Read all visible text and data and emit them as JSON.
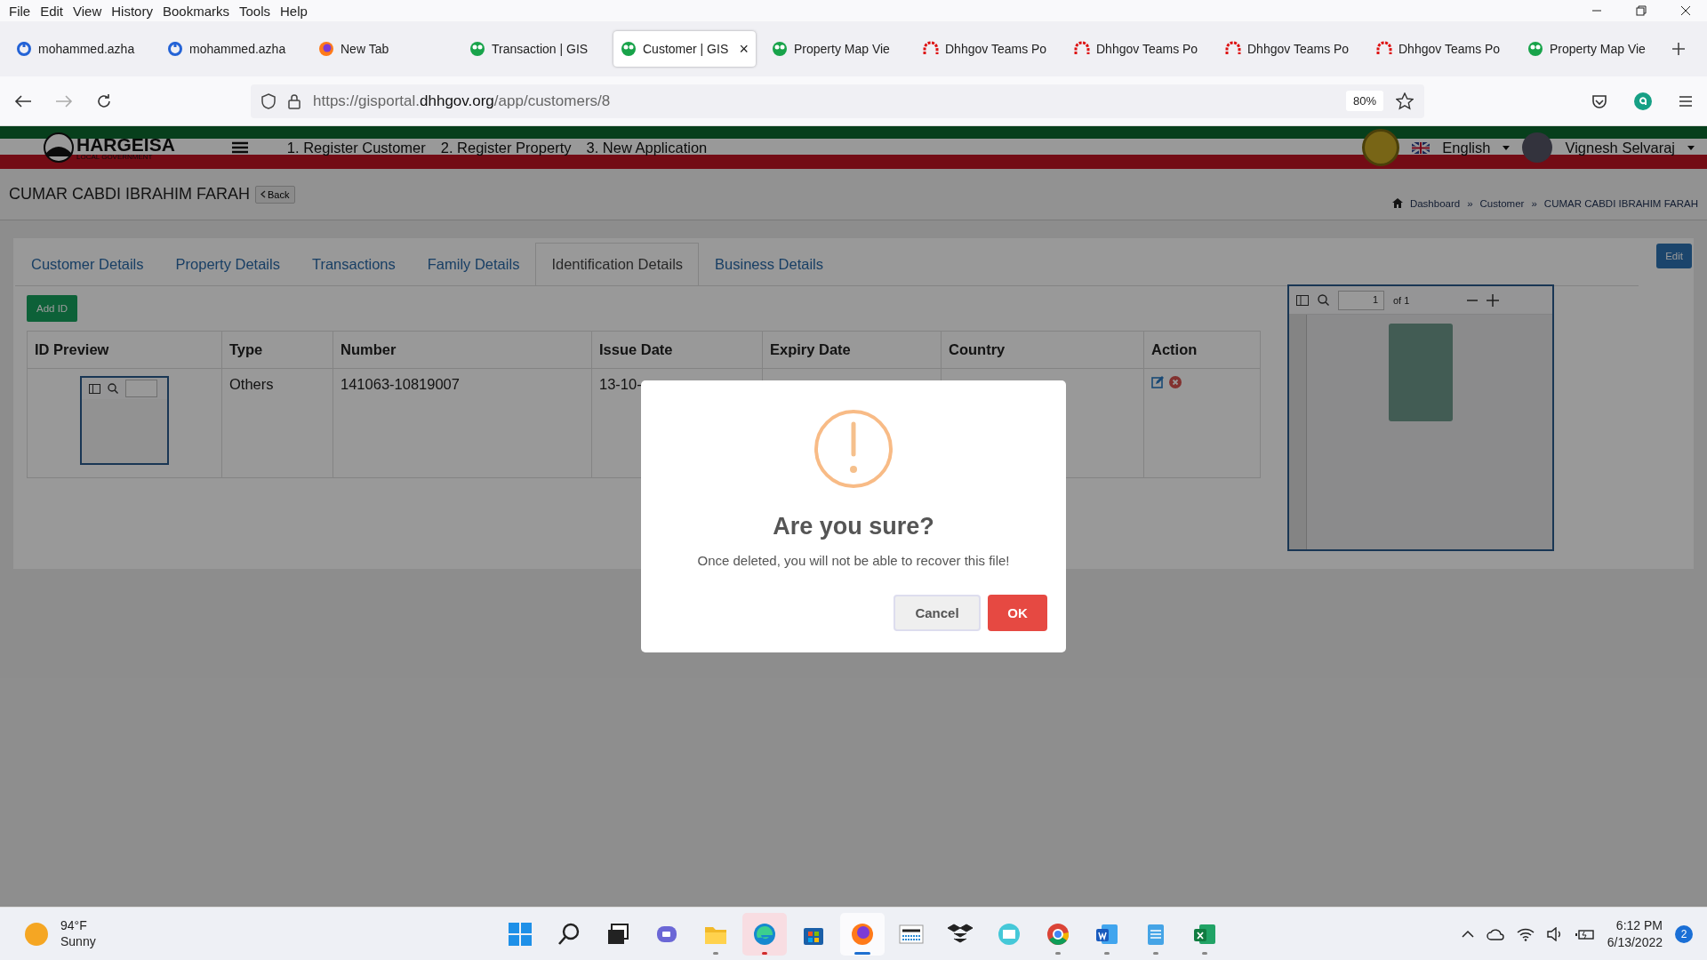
{
  "menu_bar": [
    "File",
    "Edit",
    "View",
    "History",
    "Bookmarks",
    "Tools",
    "Help"
  ],
  "browser_tabs": [
    {
      "title": "mohammed.azha",
      "kind": "ring",
      "selected": false
    },
    {
      "title": "mohammed.azha",
      "kind": "ring",
      "selected": false
    },
    {
      "title": "New Tab",
      "kind": "fox",
      "selected": false
    },
    {
      "title": "Transaction | GIS",
      "kind": "globe",
      "selected": false
    },
    {
      "title": "Customer | GIS",
      "kind": "globe",
      "selected": true,
      "close": "×"
    },
    {
      "title": "Property Map Vie",
      "kind": "globe",
      "selected": false
    },
    {
      "title": "Dhhgov Teams Po",
      "kind": "arch",
      "selected": false
    },
    {
      "title": "Dhhgov Teams Po",
      "kind": "arch",
      "selected": false
    },
    {
      "title": "Dhhgov Teams Po",
      "kind": "arch",
      "selected": false
    },
    {
      "title": "Dhhgov Teams Po",
      "kind": "arch",
      "selected": false
    },
    {
      "title": "Property Map Vie",
      "kind": "globe",
      "selected": false
    }
  ],
  "address_bar": {
    "url_start": "https://gisportal.",
    "url_domain": "dhhgov.org",
    "url_path": "/app/customers/8",
    "zoom": "80%"
  },
  "app_header": {
    "logo_title": "HARGEISA",
    "logo_subtitle": "LOCAL GOVERNMENT",
    "nav_links": [
      "1. Register Customer",
      "2. Register Property",
      "3. New Application"
    ],
    "language": "English",
    "user": "Vignesh Selvaraj"
  },
  "page_title": {
    "name": "CUMAR CABDI IBRAHIM FARAH",
    "back": "Back"
  },
  "breadcrumbs": {
    "separator": "»",
    "items": [
      "Dashboard",
      "Customer",
      "CUMAR CABDI IBRAHIM FARAH"
    ]
  },
  "tabs": [
    {
      "label": "Customer Details",
      "selected": false
    },
    {
      "label": "Property Details",
      "selected": false
    },
    {
      "label": "Transactions",
      "selected": false
    },
    {
      "label": "Family Details",
      "selected": false
    },
    {
      "label": "Identification Details",
      "selected": true
    },
    {
      "label": "Business Details",
      "selected": false
    }
  ],
  "edit_button": "Edit",
  "add_id_button": "Add ID",
  "table": {
    "columns": [
      "ID Preview",
      "Type",
      "Number",
      "Issue Date",
      "Expiry Date",
      "Country",
      "Action"
    ],
    "rows": [
      {
        "type": "Others",
        "number": "141063-10819007",
        "issue_date": "13-10-"
      }
    ]
  },
  "pdf_viewer": {
    "page": "1",
    "page_count": "of 1"
  },
  "dialog": {
    "title": "Are you sure?",
    "text": "Once deleted, you will not be able to recover this file!",
    "buttons": [
      {
        "label": "Cancel",
        "kind": "secondary"
      },
      {
        "label": "OK",
        "kind": "danger"
      }
    ]
  },
  "taskbar": {
    "weather": {
      "temp": "94°F",
      "condition": "Sunny"
    },
    "apps": [
      {
        "kind": "start",
        "running": false,
        "selected": false,
        "flashing": false
      },
      {
        "kind": "search",
        "running": false,
        "selected": false,
        "flashing": false
      },
      {
        "kind": "taskview",
        "running": false,
        "selected": false,
        "flashing": false
      },
      {
        "kind": "chat",
        "running": false,
        "selected": false,
        "flashing": false
      },
      {
        "kind": "folder",
        "running": true,
        "selected": false,
        "flashing": false
      },
      {
        "kind": "edge",
        "running": true,
        "selected": false,
        "flashing": true
      },
      {
        "kind": "store",
        "running": false,
        "selected": false,
        "flashing": false
      },
      {
        "kind": "fox",
        "running": true,
        "selected": true,
        "flashing": false
      },
      {
        "kind": "shop",
        "running": false,
        "selected": false,
        "flashing": false
      },
      {
        "kind": "box",
        "running": false,
        "selected": false,
        "flashing": false
      },
      {
        "kind": "mail",
        "running": false,
        "selected": false,
        "flashing": false
      },
      {
        "kind": "chrome",
        "running": true,
        "selected": false,
        "flashing": false
      },
      {
        "kind": "word",
        "running": true,
        "selected": false,
        "flashing": false
      },
      {
        "kind": "notepad",
        "running": true,
        "selected": false,
        "flashing": false
      },
      {
        "kind": "excel",
        "running": true,
        "selected": false,
        "flashing": false
      }
    ],
    "time": "6:12 PM",
    "date": "6/13/2022",
    "notifications": "2"
  }
}
